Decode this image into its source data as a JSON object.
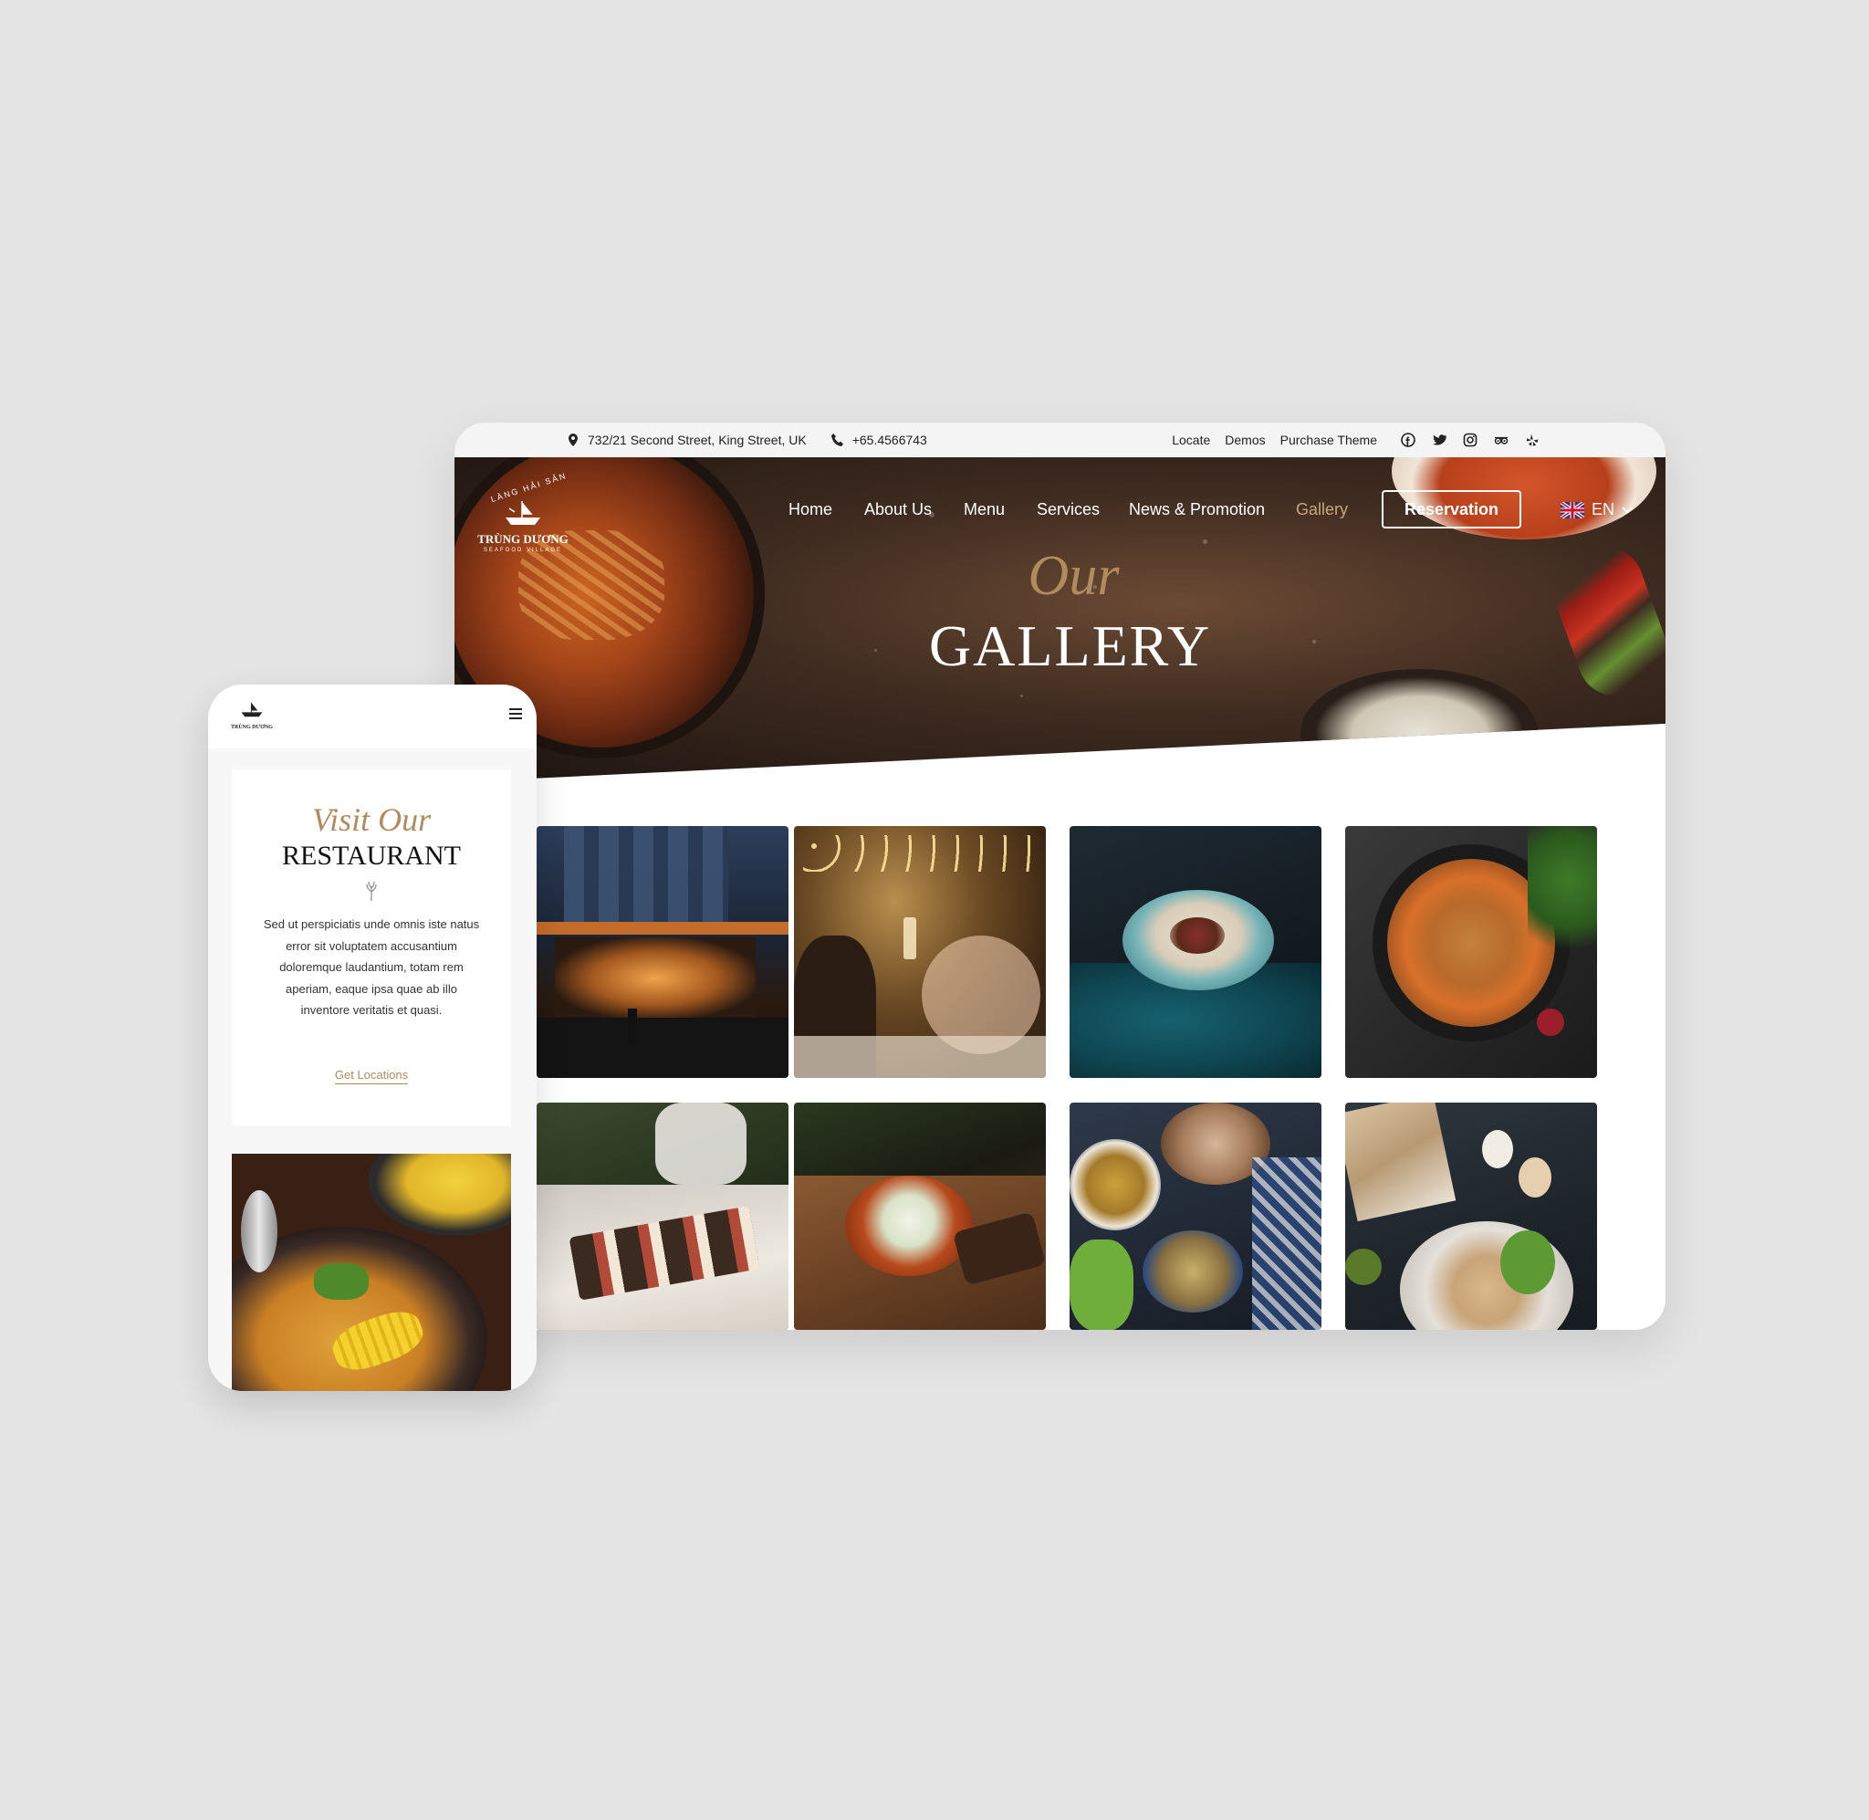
{
  "topbar": {
    "address": "732/21 Second Street, King Street, UK",
    "phone": "+65.4566743",
    "links": [
      "Locate",
      "Demos",
      "Purchase Theme"
    ],
    "social_icons": [
      "facebook-icon",
      "twitter-icon",
      "instagram-icon",
      "tripadvisor-icon",
      "yelp-icon"
    ]
  },
  "brand": {
    "arc_text": "LÀNG HẢI SẢN",
    "name": "TRÙNG DƯƠNG",
    "tagline": "SEAFOOD VILLAGE"
  },
  "nav": {
    "items": [
      "Home",
      "About Us",
      "Menu",
      "Services",
      "News & Promotion",
      "Gallery"
    ],
    "active": "Gallery",
    "reservation_label": "Reservation",
    "language": "EN"
  },
  "hero": {
    "script": "Our",
    "title": "GALLERY"
  },
  "gallery": {
    "images": [
      "restaurant-exterior-photo",
      "dining-toast-photo",
      "dish-bowl-photo",
      "stew-pan-photo",
      "dessert-platter-photo",
      "copper-pot-photo",
      "table-spread-photo",
      "breakfast-table-photo"
    ]
  },
  "mobile": {
    "script": "Visit Our",
    "title": "RESTAURANT",
    "body": "Sed ut perspiciatis unde omnis iste natus error sit voluptatem accusantium doloremque laudantium, totam rem aperiam, eaque ipsa quae ab illo inventore veritatis et quasi.",
    "link_label": "Get Locations"
  },
  "colors": {
    "accent": "#c7a77b",
    "background": "#e4e4e4",
    "hero_dark": "#2b1e17"
  }
}
